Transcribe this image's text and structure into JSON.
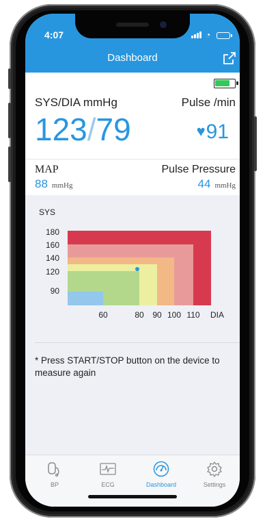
{
  "status_bar": {
    "time": "4:07"
  },
  "header": {
    "title": "Dashboard"
  },
  "readings": {
    "sysdia_label": "SYS/DIA  mmHg",
    "pulse_label": "Pulse  /min",
    "sys": "123",
    "separator": "/",
    "dia": "79",
    "pulse": "91",
    "map_label": "MAP",
    "map_value": "88",
    "map_unit": "mmHg",
    "pp_label": "Pulse Pressure",
    "pp_value": "44",
    "pp_unit": "mmHg"
  },
  "chart_data": {
    "type": "heatmap",
    "ylabel": "SYS",
    "xlabel": "DIA",
    "y_ticks": [
      "180",
      "160",
      "140",
      "120",
      "90"
    ],
    "x_ticks": [
      "60",
      "80",
      "90",
      "100",
      "110"
    ],
    "zones": [
      {
        "sys_max": 180,
        "dia_max": 120,
        "color": "#d73a4e"
      },
      {
        "sys_max": 160,
        "dia_max": 110,
        "color": "#e89a9a"
      },
      {
        "sys_max": 140,
        "dia_max": 100,
        "color": "#f2b886"
      },
      {
        "sys_max": 130,
        "dia_max": 90,
        "color": "#ecef9f"
      },
      {
        "sys_max": 120,
        "dia_max": 80,
        "color": "#b3d88c"
      },
      {
        "sys_max": 90,
        "dia_max": 60,
        "color": "#93c7ec"
      }
    ],
    "point": {
      "dia": 79,
      "sys": 123
    },
    "point_color": "#2896df"
  },
  "note": "* Press START/STOP button on the device to measure again",
  "tabs": [
    {
      "label": "BP",
      "icon": "bp-cuff-icon",
      "active": false
    },
    {
      "label": "ECG",
      "icon": "ecg-icon",
      "active": false
    },
    {
      "label": "Dashboard",
      "icon": "dashboard-gauge-icon",
      "active": true
    },
    {
      "label": "Settings",
      "icon": "gear-icon",
      "active": false
    }
  ],
  "colors": {
    "accent": "#2896df",
    "battery": "#34c759"
  }
}
